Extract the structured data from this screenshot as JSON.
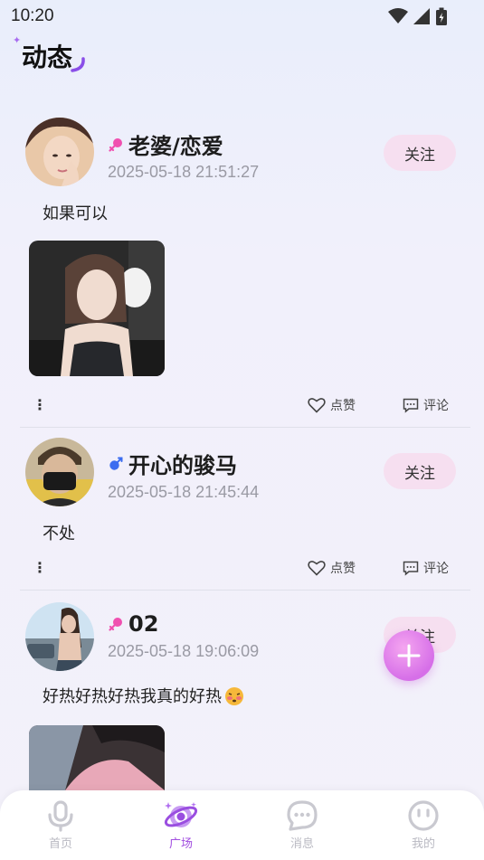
{
  "status_bar": {
    "time": "10:20"
  },
  "header": {
    "title": "动态"
  },
  "posts": [
    {
      "username": "老婆/恋爱",
      "gender": "female",
      "time": "2025-05-18 21:51:27",
      "follow_label": "关注",
      "text": "如果可以",
      "has_photo": true,
      "like_label": "点赞",
      "comment_label": "评论"
    },
    {
      "username": "开心的骏马",
      "gender": "male",
      "time": "2025-05-18 21:45:44",
      "follow_label": "关注",
      "text": "不处",
      "has_photo": false,
      "like_label": "点赞",
      "comment_label": "评论"
    },
    {
      "username": "02",
      "gender": "female",
      "time": "2025-05-18 19:06:09",
      "follow_label": "关注",
      "text": "好热好热好热我真的好热",
      "has_photo": true
    }
  ],
  "tabbar": {
    "items": [
      {
        "label": "首页",
        "icon": "microphone-icon",
        "active": false
      },
      {
        "label": "广场",
        "icon": "planet-icon",
        "active": true
      },
      {
        "label": "消息",
        "icon": "chat-bubble-icon",
        "active": false
      },
      {
        "label": "我的",
        "icon": "smiley-icon",
        "active": false
      }
    ]
  },
  "colors": {
    "accent": "#a24ee0",
    "follow_bg": "#f6dff0",
    "female": "#f050b0",
    "male": "#3b6cf0",
    "fab": "#d66fe8"
  }
}
